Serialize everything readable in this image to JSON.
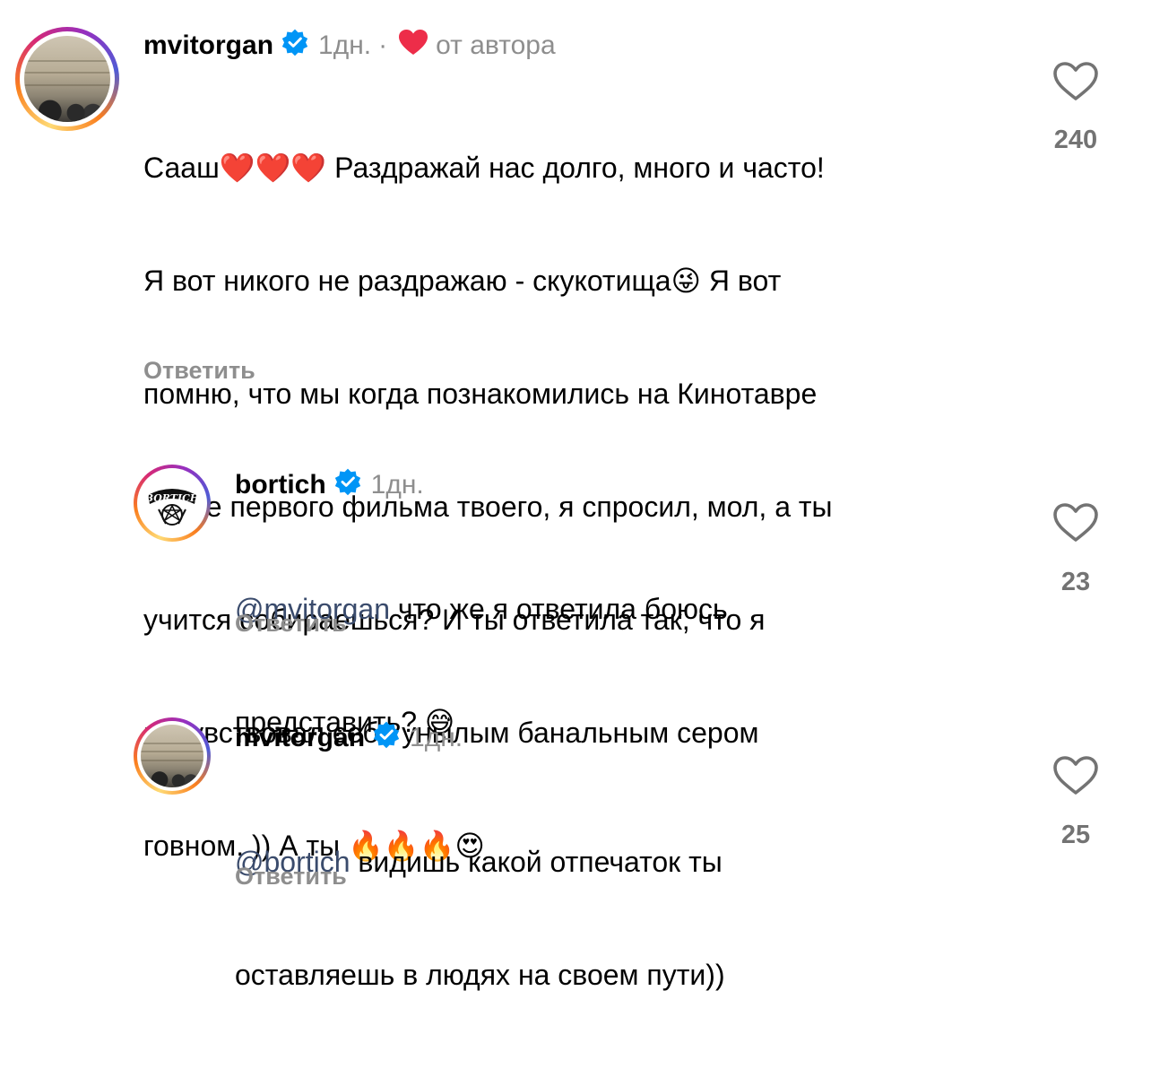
{
  "comments": [
    {
      "username": "mvitorgan",
      "time": "1дн.",
      "separator": "·",
      "author_label": "от автора",
      "lines": [
        "Сааш❤️❤️❤️ Раздражай нас долго, много и часто!",
        "Я вот никого не раздражаю - скукотища😜 Я вот",
        "помню, что мы когда познакомились на Кинотавре",
        "после первого фильма твоего, я спросил, мол, а ты",
        "учится собираешься? И ты ответила так, что я",
        "почувствовал себя унылым банальным сером",
        "говном. )) А ты 🔥🔥🔥😍"
      ],
      "reply": "Ответить",
      "likes": "240"
    },
    {
      "username": "bortich",
      "time": "1дн.",
      "mention": "@mvitorgan",
      "line1_rest": " что же я ответила боюсь",
      "line2": "представить? 😅",
      "reply": "Ответить",
      "likes": "23",
      "avatar_text": "BORTICH"
    },
    {
      "username": "mvitorgan",
      "time": "1дн.",
      "mention": "@bortich",
      "line1_rest": " видишь какой отпечаток ты",
      "line2": "оставляешь в людях на своем пути))",
      "reply": "Ответить",
      "likes": "25"
    }
  ],
  "colors": {
    "secondary_text": "#8e8e8e",
    "mention": "#3a4b6c",
    "verified": "#0095f6",
    "heart_red": "#ed2d49"
  }
}
